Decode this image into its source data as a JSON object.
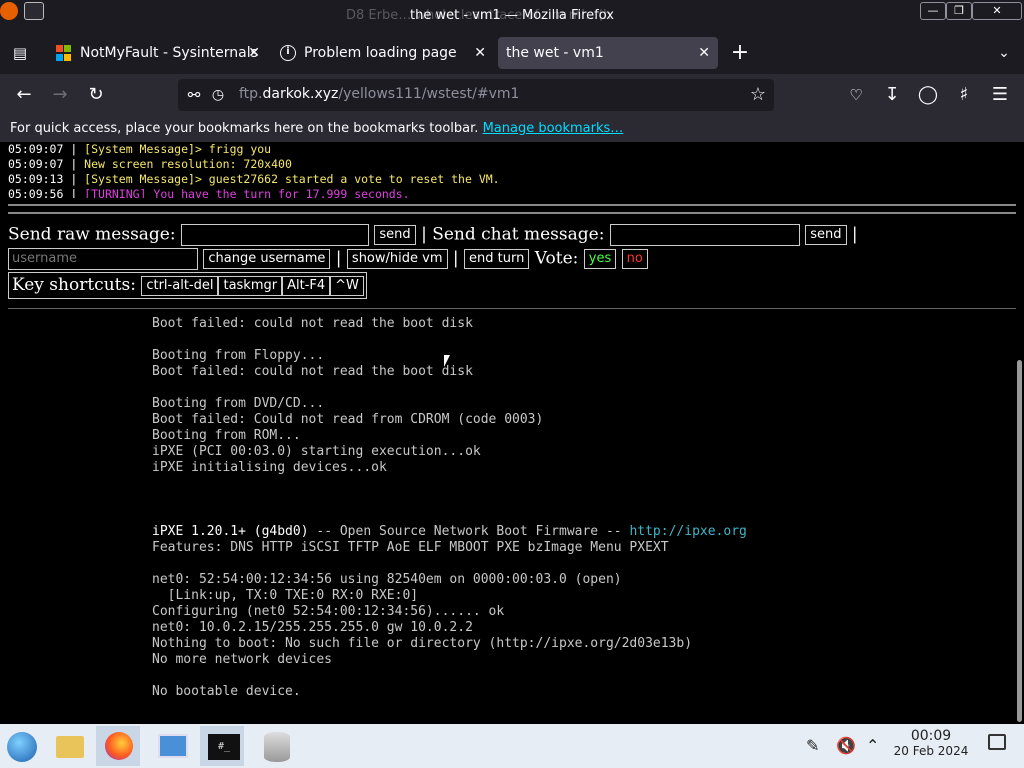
{
  "window": {
    "title": "the wet - vm1 — Mozilla Firefox",
    "title_ghost": "D8 Erbe… wholecleantrace of…m ml…(h"
  },
  "tabs": [
    {
      "label": "NotMyFault - Sysinternals",
      "icon": "microsoft-logo-icon"
    },
    {
      "label": "Problem loading page",
      "icon": "info-icon"
    },
    {
      "label": "the wet - vm1",
      "icon": "",
      "active": true
    }
  ],
  "nav": {
    "url_prefix": "ftp.",
    "url_domain": "darkok.xyz",
    "url_path": "/yellows111/wstest/#vm1"
  },
  "bookmarks_bar": {
    "text": "For quick access, place your bookmarks here on the bookmarks toolbar. ",
    "link": "Manage bookmarks…"
  },
  "chat": [
    {
      "time": "05:09:07",
      "sep": " | ",
      "msg": "[System Message]> frigg you",
      "kind": "sys"
    },
    {
      "time": "05:09:07",
      "sep": " | ",
      "msg": "New screen resolution: 720x400",
      "kind": "ann"
    },
    {
      "time": "05:09:13",
      "sep": " | ",
      "msg": "[System Message]> guest27662 started a vote to reset the VM.",
      "kind": "sys"
    },
    {
      "time": "05:09:56",
      "sep": " | ",
      "msg": "[TURNING] You have the turn for 17.999 seconds.",
      "kind": "turn"
    }
  ],
  "controls": {
    "raw_label": "Send raw message:",
    "send": "send",
    "pipe": "|",
    "chat_label": "Send chat message:",
    "username_placeholder": "username",
    "change_username": "change username",
    "show_hide": "show/hide vm",
    "end_turn": "end turn",
    "vote_label": "Vote:",
    "yes": "yes",
    "no": "no",
    "key_label": "Key shortcuts:",
    "keys": [
      "ctrl-alt-del",
      "taskmgr",
      "Alt-F4",
      "^W"
    ]
  },
  "console": {
    "l1": "Boot failed: could not read the boot disk",
    "l2": "Booting from Floppy...",
    "l3": "Boot failed: could not read the boot disk",
    "l4": "Booting from DVD/CD...",
    "l5": "Boot failed: Could not read from CDROM (code 0003)",
    "l6": "Booting from ROM...",
    "l7": "iPXE (PCI 00:03.0) starting execution...ok",
    "l8": "iPXE initialising devices...ok",
    "l9a": "iPXE 1.20.1+ (g4bd0)",
    "l9b": " -- Open Source Network Boot Firmware -- ",
    "l9c": "http://ipxe.org",
    "l10": "Features: DNS HTTP iSCSI TFTP AoE ELF MBOOT PXE bzImage Menu PXEXT",
    "l11": "net0: 52:54:00:12:34:56 using 82540em on 0000:00:03.0 (open)",
    "l12": "  [Link:up, TX:0 TXE:0 RX:0 RXE:0]",
    "l13": "Configuring (net0 52:54:00:12:34:56)...... ok",
    "l14": "net0: 10.0.2.15/255.255.255.0 gw 10.0.2.2",
    "l15": "Nothing to boot: No such file or directory (http://ipxe.org/2d03e13b)",
    "l16": "No more network devices",
    "l17": "No bootable device."
  },
  "taskbar": {
    "time": "00:09",
    "date": "20 Feb 2024"
  }
}
